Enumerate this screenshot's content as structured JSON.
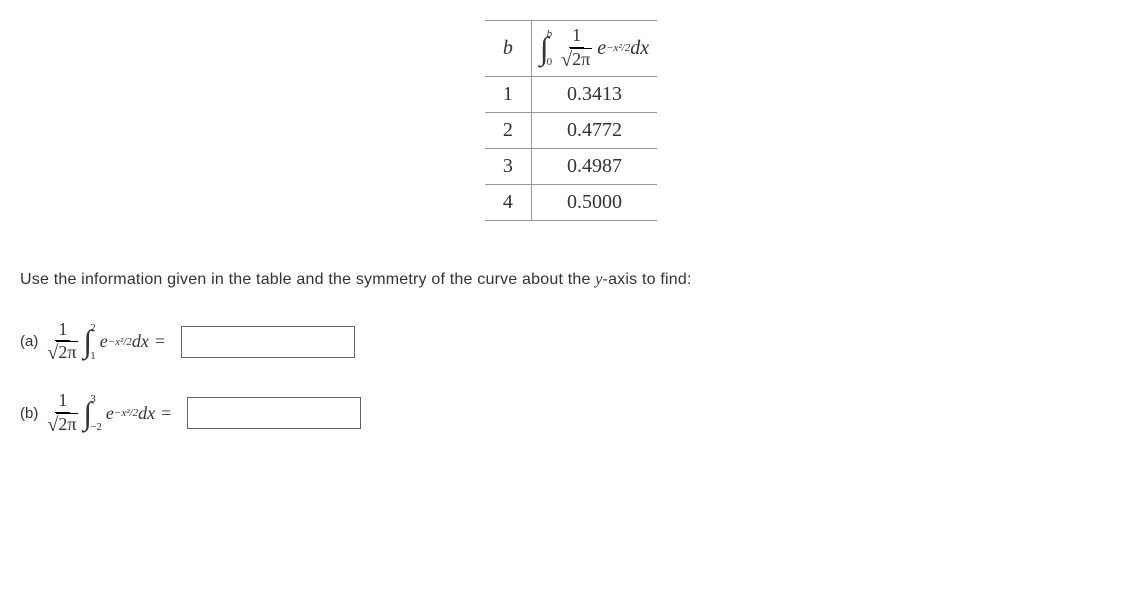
{
  "table": {
    "header_b": "b",
    "header_formula": {
      "int_upper": "b",
      "int_lower": "0",
      "frac_num": "1",
      "frac_den_sqrt": "2π",
      "e_exp": "−x²/2",
      "dx": "dx"
    },
    "rows": [
      {
        "b": "1",
        "value": "0.3413"
      },
      {
        "b": "2",
        "value": "0.4772"
      },
      {
        "b": "3",
        "value": "0.4987"
      },
      {
        "b": "4",
        "value": "0.5000"
      }
    ]
  },
  "instruction": {
    "text_before": "Use the information given in the table and the symmetry of the curve about the ",
    "y_axis": "y",
    "text_after": "-axis to find:"
  },
  "questions": {
    "a": {
      "label": "(a)",
      "frac_num": "1",
      "frac_den_sqrt": "2π",
      "int_upper": "2",
      "int_lower": "1",
      "e": "e",
      "exp": "−x²/2",
      "dx": "dx",
      "equals": "="
    },
    "b": {
      "label": "(b)",
      "frac_num": "1",
      "frac_den_sqrt": "2π",
      "int_upper": "3",
      "int_lower": "−2",
      "e": "e",
      "exp": "−x²/2",
      "dx": "dx",
      "equals": "="
    }
  }
}
